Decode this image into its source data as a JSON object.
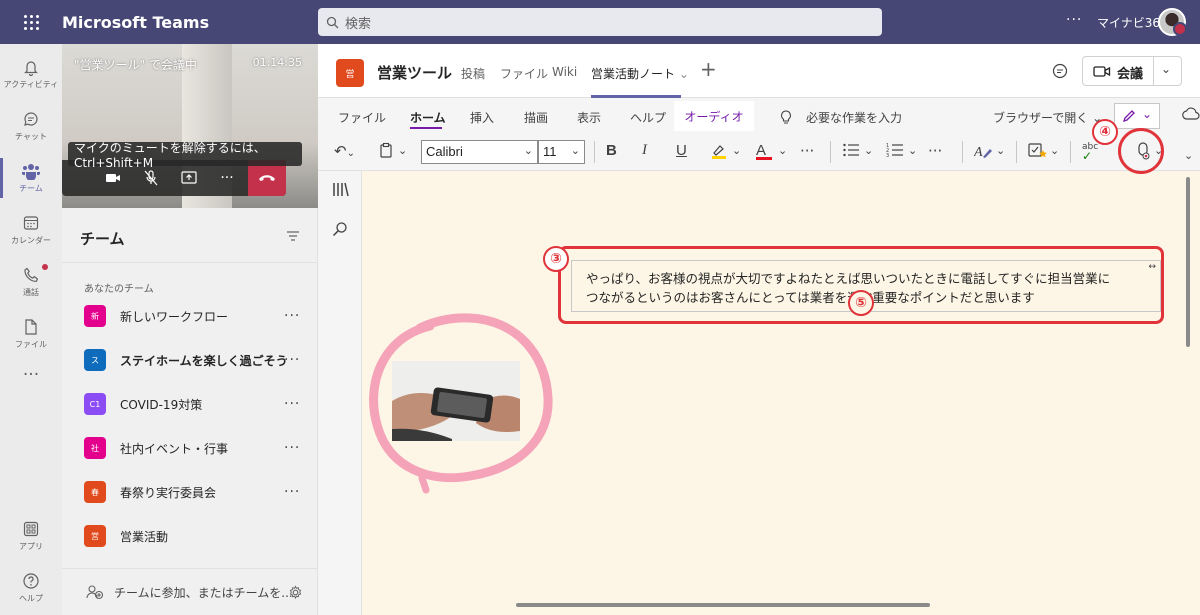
{
  "app": {
    "title": "Microsoft Teams",
    "search_placeholder": "検索",
    "more": "···",
    "user_name": "マイナビ365"
  },
  "rail": [
    {
      "label": "アクティビティ",
      "icon": "bell-icon"
    },
    {
      "label": "チャット",
      "icon": "chat-icon"
    },
    {
      "label": "チーム",
      "icon": "teams-icon",
      "active": true
    },
    {
      "label": "カレンダー",
      "icon": "calendar-icon"
    },
    {
      "label": "通話",
      "icon": "phone-icon"
    },
    {
      "label": "ファイル",
      "icon": "file-icon"
    },
    {
      "label": "···",
      "icon": "more-icon"
    },
    {
      "label": "アプリ",
      "icon": "apps-icon"
    },
    {
      "label": "ヘルプ",
      "icon": "help-icon"
    }
  ],
  "meeting": {
    "title": "\"営業ツール\" で会議中",
    "time": "01:14:35",
    "unmute_tip": "マイクのミュートを解除するには、Ctrl+Shift+M"
  },
  "teams_panel": {
    "heading": "チーム",
    "section_label": "あなたのチーム",
    "teams": [
      {
        "abbr": "新",
        "name": "新しいワークフロー",
        "color": "#e3008c",
        "bold": false
      },
      {
        "abbr": "ス",
        "name": "ステイホームを楽しく過ごそう",
        "color": "#0f6cbd",
        "bold": true
      },
      {
        "abbr": "C1",
        "name": "COVID-19対策",
        "color": "#8b4cf3",
        "bold": false
      },
      {
        "abbr": "社",
        "name": "社内イベント・行事",
        "color": "#e3008c",
        "bold": false
      },
      {
        "abbr": "春",
        "name": "春祭り実行委員会",
        "color": "#e04a1c",
        "bold": false
      },
      {
        "abbr": "営",
        "name": "営業活動",
        "color": "#e04a1c",
        "bold": false
      }
    ],
    "join_text": "チームに参加、またはチームを..."
  },
  "channel": {
    "avatar": "営",
    "name": "営業ツール",
    "tabs": [
      "投稿",
      "ファイル",
      "Wiki",
      "営業活動ノート"
    ],
    "meet_label": "会議"
  },
  "ribbon": {
    "tabs": [
      "ファイル",
      "ホーム",
      "挿入",
      "描画",
      "表示",
      "ヘルプ"
    ],
    "audio_tab": "オーディオ",
    "tell_me": "必要な作業を入力",
    "browser_open": "ブラウザーで開く",
    "font": "Calibri",
    "size": "11"
  },
  "note": {
    "text_line1": "やっぱり、お客様の視点が大切ですよねたとえば思いついたときに電話してすぐに担当営業に",
    "text_line2": "つながるというのはお客さんにとっては業者を選ぶ重要なポイントだと思います"
  },
  "annotations": {
    "badge3": "③",
    "badge4": "④",
    "badge5": "⑤"
  }
}
